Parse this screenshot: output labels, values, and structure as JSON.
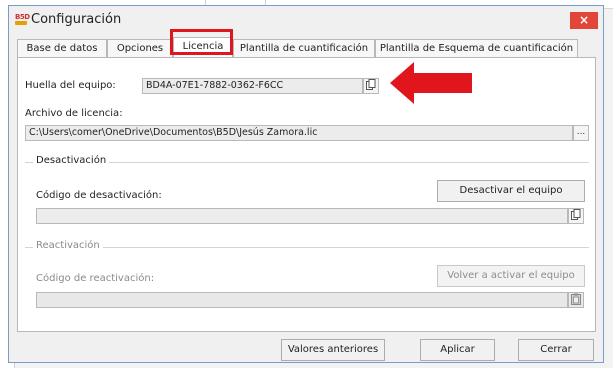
{
  "window": {
    "title": "Configuración",
    "close_label": "×",
    "app_icon": "b5d-app-icon"
  },
  "tabs": [
    {
      "label": "Base de datos",
      "active": false
    },
    {
      "label": "Opciones",
      "active": false
    },
    {
      "label": "Licencia",
      "active": true
    },
    {
      "label": "Plantilla de cuantificación",
      "active": false
    },
    {
      "label": "Plantilla de Esquema de cuantificación",
      "active": false
    }
  ],
  "licencia": {
    "huella_label": "Huella del equipo:",
    "huella_value": "BD4A-07E1-7882-0362-F6CC",
    "archivo_label": "Archivo de licencia:",
    "archivo_value": "C:\\Users\\comer\\OneDrive\\Documentos\\B5D\\Jesús Zamora.lic",
    "browse_label": "...",
    "desactivacion": {
      "group_title": "Desactivación",
      "codigo_label": "Código de desactivación:",
      "button_label": "Desactivar el equipo",
      "codigo_value": ""
    },
    "reactivacion": {
      "group_title": "Reactivación",
      "codigo_label": "Código de reactivación:",
      "button_label": "Volver a activar el equipo",
      "codigo_value": ""
    }
  },
  "footer": {
    "restore_label": "Valores anteriores",
    "apply_label": "Aplicar",
    "close_label": "Cerrar"
  },
  "colors": {
    "highlight": "#e1151c",
    "close_button": "#e2453a",
    "accent_border": "#7a9cc6"
  }
}
